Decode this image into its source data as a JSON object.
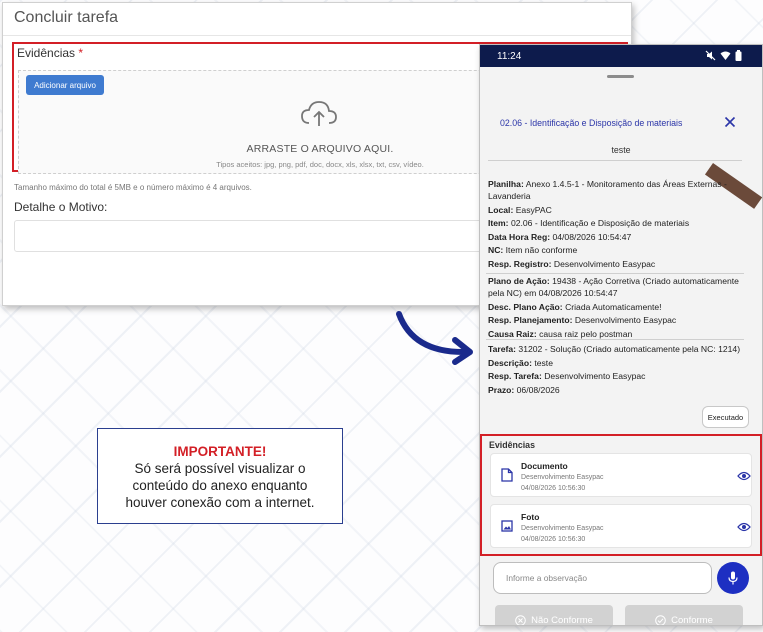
{
  "web_form": {
    "title": "Concluir tarefa",
    "evidence_label": "Evidências",
    "required_mark": "*",
    "add_file_button": "Adicionar arquivo",
    "drop_text": "ARRASTE O ARQUIVO AQUI.",
    "accepted_types": "Tipos aceitos: jpg, png, pdf, doc, docx, xls, xlsx, txt, csv, vídeo.",
    "size_note": "Tamanho máximo do total é 5MB e o número máximo é 4 arquivos.",
    "detail_label": "Detalhe o Motivo:",
    "detail_value": ""
  },
  "notice": {
    "title": "IMPORTANTE!",
    "line1": "Só será possível visualizar o",
    "line2": "conteúdo do anexo enquanto",
    "line3": "houver conexão com a internet."
  },
  "phone": {
    "status_time": "11:24",
    "sheet_title": "02.06 - Identificação e Disposição de materiais",
    "sheet_subtitle": "teste",
    "details_group1": [
      {
        "label": "Planilha:",
        "value": "Anexo 1.4.5-1 - Monitoramento das Áreas Externas - Lavanderia"
      },
      {
        "label": "Local:",
        "value": "EasyPAC"
      },
      {
        "label": "Item:",
        "value": "02.06 - Identificação e Disposição de materiais"
      },
      {
        "label": "Data Hora Reg:",
        "value": "04/08/2026 10:54:47"
      },
      {
        "label": "NC:",
        "value": "Item não conforme"
      },
      {
        "label": "Resp. Registro:",
        "value": "Desenvolvimento Easypac"
      }
    ],
    "details_group2": [
      {
        "label": "Plano de Ação:",
        "value": "19438 - Ação Corretiva (Criado automaticamente pela NC) em 04/08/2026 10:54:47"
      },
      {
        "label": "Desc. Plano Ação:",
        "value": "Criada Automaticamente!"
      },
      {
        "label": "Resp. Planejamento:",
        "value": "Desenvolvimento Easypac"
      },
      {
        "label": "Causa Raiz:",
        "value": "causa raiz pelo postman"
      }
    ],
    "details_group3": [
      {
        "label": "Tarefa:",
        "value": "31202 - Solução (Criado automaticamente pela NC: 1214)"
      },
      {
        "label": "Descrição:",
        "value": "teste"
      },
      {
        "label": "Resp. Tarefa:",
        "value": "Desenvolvimento Easypac"
      },
      {
        "label": "Prazo:",
        "value": "06/08/2026"
      }
    ],
    "executed_button": "Executado",
    "evidence_title": "Evidências",
    "evidences": [
      {
        "title": "Documento",
        "user": "Desenvolvimento Easypac",
        "date": "04/08/2026 10:56:30",
        "icon": "document-icon"
      },
      {
        "title": "Foto",
        "user": "Desenvolvimento Easypac",
        "date": "04/08/2026 10:56:30",
        "icon": "image-icon"
      }
    ],
    "observation_placeholder": "Informe a observação",
    "non_conform_button": "Não Conforme",
    "conform_button": "Conforme"
  },
  "colors": {
    "highlight": "#d31f26",
    "primary": "#1d2fc2",
    "status_bar": "#0d1b4c",
    "upload_button": "#3f7bd0"
  }
}
